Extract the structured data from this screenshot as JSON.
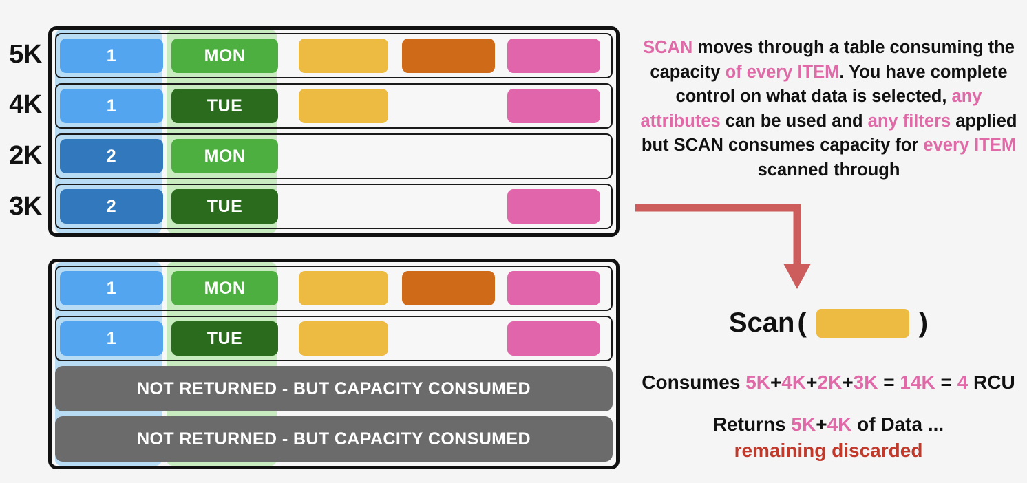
{
  "background_color": "#f5f5f5",
  "colors": {
    "blue_light": "#54a5f0",
    "blue_dark": "#3178bd",
    "green_light": "#4caf3f",
    "green_dark": "#2a6b1e",
    "yellow": "#edba42",
    "orange": "#cf6a18",
    "pink": "#e065ab",
    "gray": "#6b6b6b",
    "accent_pink": "#e06aa8",
    "accent_rust": "#c0392b",
    "arrow": "#cd5c5c"
  },
  "top_table": {
    "row_labels": [
      "5K",
      "4K",
      "2K",
      "3K"
    ],
    "rows": [
      {
        "id": "1",
        "day": "MON",
        "id_color": "blue_light",
        "day_color": "green_light",
        "cells": [
          "yellow",
          "orange",
          "pink"
        ]
      },
      {
        "id": "1",
        "day": "TUE",
        "id_color": "blue_light",
        "day_color": "green_dark",
        "cells": [
          "yellow",
          "",
          "pink"
        ]
      },
      {
        "id": "2",
        "day": "MON",
        "id_color": "blue_dark",
        "day_color": "green_light",
        "cells": [
          "",
          "",
          ""
        ]
      },
      {
        "id": "2",
        "day": "TUE",
        "id_color": "blue_dark",
        "day_color": "green_dark",
        "cells": [
          "",
          "",
          "pink"
        ]
      }
    ]
  },
  "bottom_table": {
    "rows": [
      {
        "id": "1",
        "day": "MON",
        "id_color": "blue_light",
        "day_color": "green_light",
        "cells": [
          "yellow",
          "orange",
          "pink"
        ]
      },
      {
        "id": "1",
        "day": "TUE",
        "id_color": "blue_light",
        "day_color": "green_dark",
        "cells": [
          "yellow",
          "",
          "pink"
        ]
      }
    ],
    "consumed_bars": [
      "NOT RETURNED - BUT CAPACITY CONSUMED",
      "NOT RETURNED - BUT CAPACITY CONSUMED"
    ]
  },
  "description": {
    "segments": [
      {
        "text": "SCAN",
        "style": "pink"
      },
      {
        "text": " moves through a table consuming the capacity ",
        "style": "plain"
      },
      {
        "text": "of every ITEM",
        "style": "pink"
      },
      {
        "text": ". You have complete control on what data is selected, ",
        "style": "plain"
      },
      {
        "text": "any attributes",
        "style": "pink"
      },
      {
        "text": " can be used and ",
        "style": "plain"
      },
      {
        "text": "any filters",
        "style": "pink"
      },
      {
        "text": " applied but SCAN consumes capacity for ",
        "style": "plain"
      },
      {
        "text": "every ITEM",
        "style": "pink"
      },
      {
        "text": " scanned through",
        "style": "plain"
      }
    ]
  },
  "scan_expression": {
    "label": "Scan",
    "open_paren": "(",
    "close_paren": ")",
    "chip_color": "yellow"
  },
  "consumes": {
    "segments": [
      {
        "text": "Consumes ",
        "style": "plain"
      },
      {
        "text": "5K",
        "style": "pink"
      },
      {
        "text": "+",
        "style": "plain"
      },
      {
        "text": "4K",
        "style": "pink"
      },
      {
        "text": "+",
        "style": "plain"
      },
      {
        "text": "2K",
        "style": "pink"
      },
      {
        "text": "+",
        "style": "plain"
      },
      {
        "text": "3K",
        "style": "pink"
      },
      {
        "text": " = ",
        "style": "plain"
      },
      {
        "text": "14K",
        "style": "pink"
      },
      {
        "text": " = ",
        "style": "plain"
      },
      {
        "text": "4",
        "style": "pink"
      },
      {
        "text": " RCU",
        "style": "plain"
      }
    ]
  },
  "returns": {
    "segments": [
      {
        "text": "Returns ",
        "style": "plain"
      },
      {
        "text": "5K",
        "style": "pink"
      },
      {
        "text": "+",
        "style": "plain"
      },
      {
        "text": "4K",
        "style": "pink"
      },
      {
        "text": " of Data ...",
        "style": "plain"
      }
    ]
  },
  "discard_text": "remaining discarded"
}
